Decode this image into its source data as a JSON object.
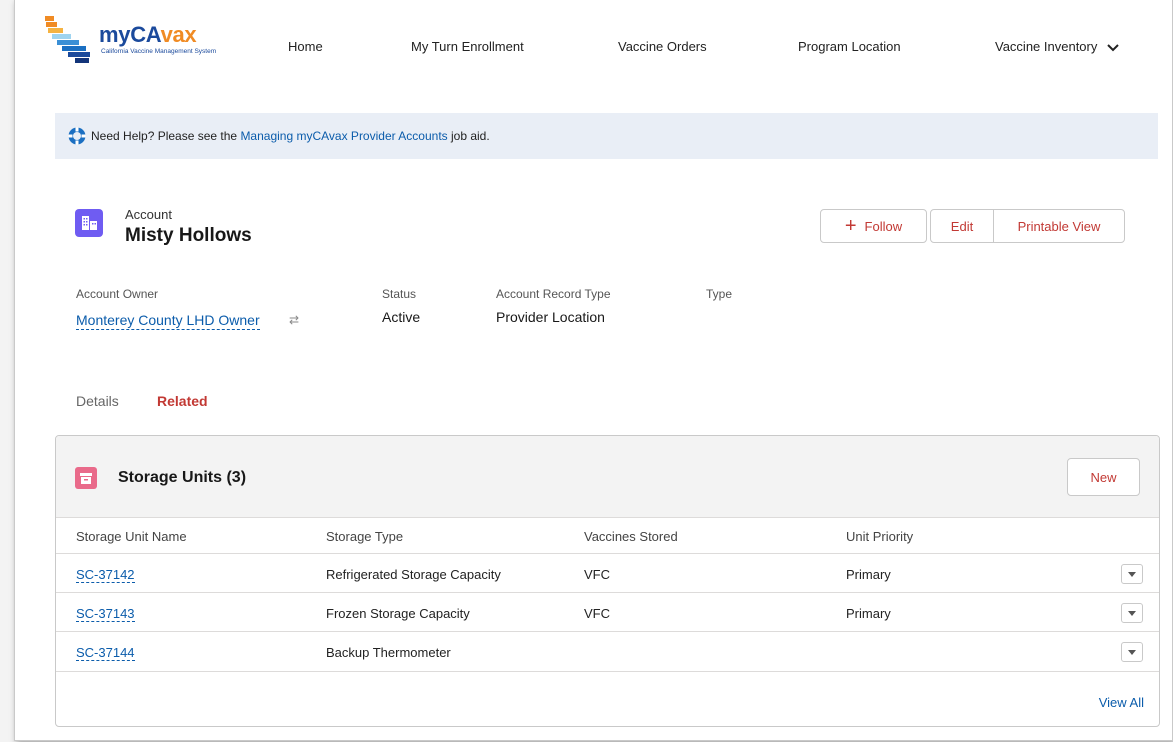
{
  "header": {
    "logo_text_main": "myCA",
    "logo_text_accent": "vax",
    "logo_subtitle": "California Vaccine Management System",
    "nav": [
      {
        "label": "Home"
      },
      {
        "label": "My Turn Enrollment"
      },
      {
        "label": "Vaccine Orders"
      },
      {
        "label": "Program Location"
      },
      {
        "label": "Vaccine Inventory"
      }
    ]
  },
  "help": {
    "prefix": "Need Help? Please see the ",
    "link": "Managing myCAvax Provider Accounts",
    "suffix": " job aid."
  },
  "record": {
    "type_label": "Account",
    "name": "Misty Hollows",
    "actions": {
      "follow": "Follow",
      "edit": "Edit",
      "printable": "Printable View"
    },
    "fields": {
      "owner_label": "Account Owner",
      "owner_value": "Monterey County LHD Owner",
      "status_label": "Status",
      "status_value": "Active",
      "record_type_label": "Account Record Type",
      "record_type_value": "Provider Location",
      "type_label": "Type"
    }
  },
  "tabs": {
    "details": "Details",
    "related": "Related"
  },
  "storage_units": {
    "title": "Storage Units (3)",
    "new_label": "New",
    "columns": [
      "Storage Unit Name",
      "Storage Type",
      "Vaccines Stored",
      "Unit Priority"
    ],
    "rows": [
      {
        "name": "SC-37142",
        "type": "Refrigerated Storage Capacity",
        "vaccines": "VFC",
        "priority": "Primary"
      },
      {
        "name": "SC-37143",
        "type": "Frozen Storage Capacity",
        "vaccines": "VFC",
        "priority": "Primary"
      },
      {
        "name": "SC-37144",
        "type": "Backup Thermometer",
        "vaccines": "",
        "priority": ""
      }
    ],
    "view_all": "View All"
  },
  "colors": {
    "link": "#0b5cab",
    "brand_action": "#c23934",
    "account_icon": "#6f5cf2",
    "storage_icon": "#e96a8a"
  }
}
